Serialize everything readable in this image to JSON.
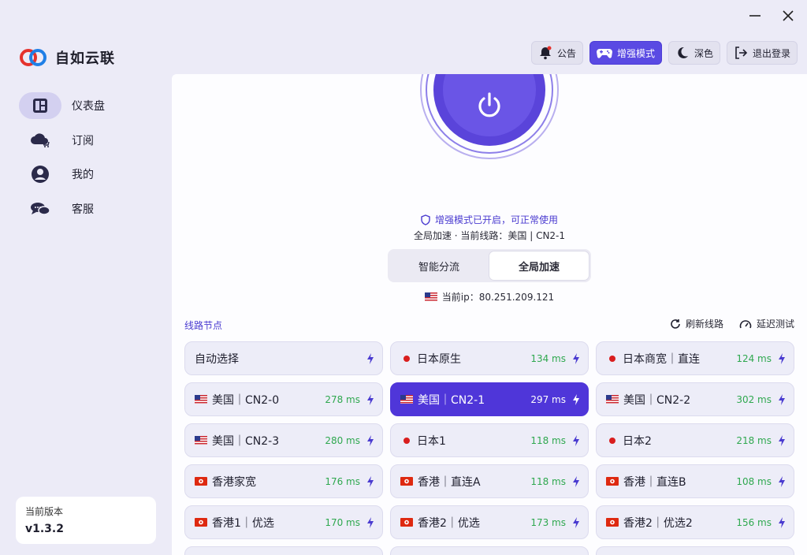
{
  "app": {
    "name": "自如云联"
  },
  "window": {
    "minimize_icon": "minimize-icon",
    "close_icon": "close-icon"
  },
  "sidebar": {
    "items": [
      {
        "label": "仪表盘",
        "icon": "dashboard-icon",
        "active": true
      },
      {
        "label": "订阅",
        "icon": "cloud-cart-icon",
        "active": false
      },
      {
        "label": "我的",
        "icon": "user-icon",
        "active": false
      },
      {
        "label": "客服",
        "icon": "chat-icon",
        "active": false
      }
    ],
    "version_label": "当前版本",
    "version_value": "v1.3.2"
  },
  "topbar": {
    "notice": "公告",
    "enhanced": "增强模式",
    "dark": "深色",
    "logout": "退出登录"
  },
  "status": {
    "enhanced_text": "增强模式已开启，可正常使用",
    "mode_text": "全局加速 · 当前线路：美国 | CN2-1",
    "ip_label": "当前ip：80.251.209.121"
  },
  "modes": {
    "smart": "智能分流",
    "global": "全局加速",
    "selected": "global"
  },
  "nodes_section": {
    "title": "线路节点",
    "refresh": "刷新线路",
    "latency_test": "延迟测试"
  },
  "colors": {
    "accent": "#5a4ae3",
    "latency_green": "#2fa84f",
    "selected_node": "#4f36d9"
  },
  "nodes": [
    {
      "name": "自动选择",
      "flag": "none",
      "latency": ""
    },
    {
      "name": "日本原生",
      "flag": "jp",
      "latency": "134 ms"
    },
    {
      "name": "日本商宽｜直连",
      "flag": "jp",
      "latency": "124 ms"
    },
    {
      "name": "美国｜CN2-0",
      "flag": "us",
      "latency": "278 ms"
    },
    {
      "name": "美国｜CN2-1",
      "flag": "us",
      "latency": "297 ms",
      "selected": true
    },
    {
      "name": "美国｜CN2-2",
      "flag": "us",
      "latency": "302 ms"
    },
    {
      "name": "美国｜CN2-3",
      "flag": "us",
      "latency": "280 ms"
    },
    {
      "name": "日本1",
      "flag": "jp",
      "latency": "118 ms"
    },
    {
      "name": "日本2",
      "flag": "jp",
      "latency": "218 ms"
    },
    {
      "name": "香港家宽",
      "flag": "hk",
      "latency": "176 ms"
    },
    {
      "name": "香港｜直连A",
      "flag": "hk",
      "latency": "118 ms"
    },
    {
      "name": "香港｜直连B",
      "flag": "hk",
      "latency": "108 ms"
    },
    {
      "name": "香港1｜优选",
      "flag": "hk",
      "latency": "170 ms"
    },
    {
      "name": "香港2｜优选",
      "flag": "hk",
      "latency": "173 ms"
    },
    {
      "name": "香港2｜优选2",
      "flag": "hk",
      "latency": "156 ms"
    }
  ]
}
